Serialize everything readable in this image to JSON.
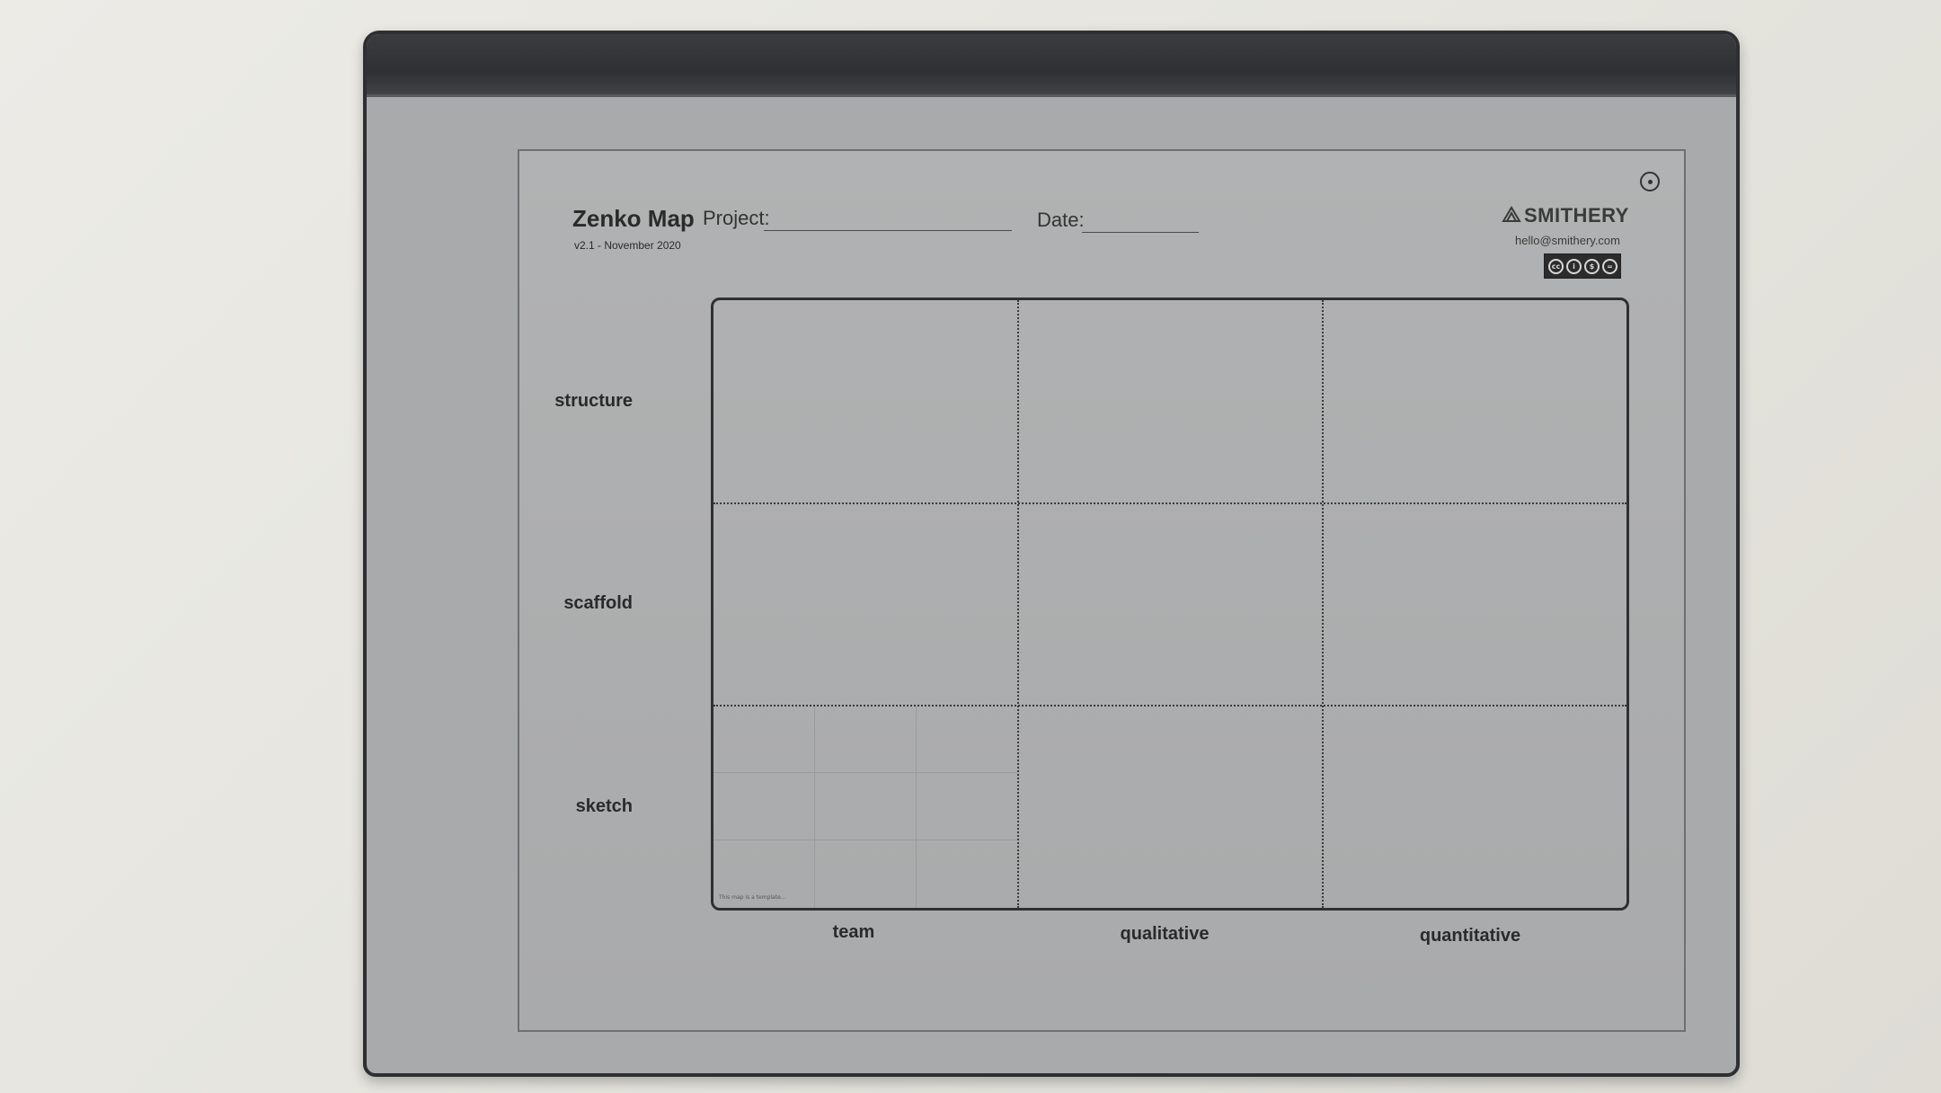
{
  "template": {
    "title": "Zenko Map",
    "version": "v2.1 - November 2020",
    "project_label": "Project:",
    "date_label": "Date:",
    "brand": {
      "name": "SMITHERY",
      "email": "hello@smithery.com",
      "license_icons": [
        "cc",
        "by",
        "nc",
        "nd"
      ]
    },
    "rows": [
      "structure",
      "scaffold",
      "sketch"
    ],
    "columns": [
      "team",
      "qualitative",
      "quantitative"
    ],
    "corner_note": "This map is a template..."
  },
  "icons": {
    "top_right": "circle-dot-icon",
    "logo": "smithery-logo-icon"
  },
  "colors": {
    "tablet_frame": "#2e2f31",
    "screen": "#adaeaf",
    "ink": "#2a2a2a"
  }
}
